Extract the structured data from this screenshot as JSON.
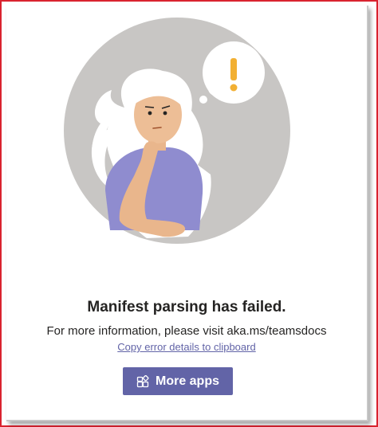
{
  "error": {
    "title": "Manifest parsing has failed.",
    "info": "For more information, please visit aka.ms/teamsdocs",
    "copy_link": "Copy error details to clipboard"
  },
  "actions": {
    "more_apps_label": "More apps",
    "more_apps_icon": "apps-add-icon"
  },
  "illustration": {
    "thought_symbol": "!",
    "accent_color": "#f2b033",
    "brand_color": "#6264a7"
  }
}
